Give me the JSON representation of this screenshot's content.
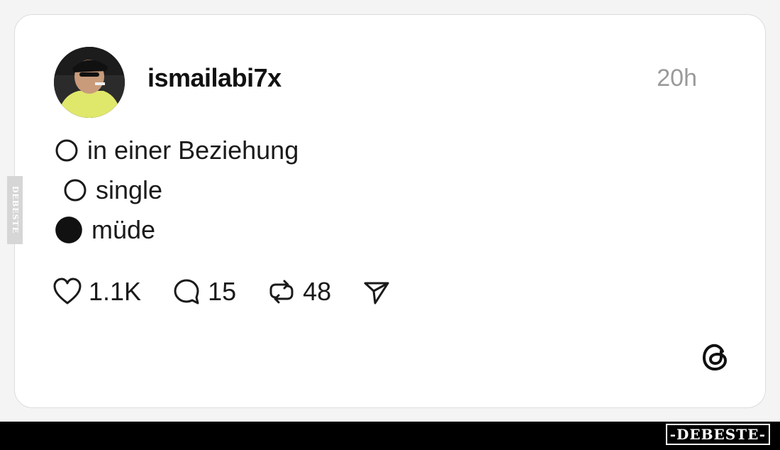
{
  "post": {
    "username": "ismailabi7x",
    "time": "20h",
    "options": [
      {
        "label": "in einer Beziehung",
        "selected": false
      },
      {
        "label": "single",
        "selected": false
      },
      {
        "label": "müde",
        "selected": true
      }
    ],
    "actions": {
      "likes": "1.1K",
      "comments": "15",
      "reposts": "48"
    }
  },
  "icons": [
    "heart-icon",
    "comment-icon",
    "repost-icon",
    "share-icon",
    "threads-logo-icon"
  ],
  "colors": {
    "card_bg": "#ffffff",
    "text": "#1a1a1a",
    "muted": "#9a9a9a",
    "bar": "#000000"
  },
  "watermark": {
    "side": "DEBESTE",
    "bottom": "-DEBESTE-"
  }
}
